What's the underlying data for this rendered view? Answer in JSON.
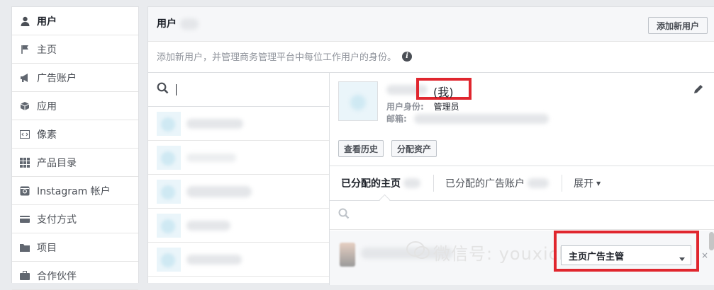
{
  "sidebar": {
    "items": [
      {
        "label": "用户",
        "icon": "person-icon"
      },
      {
        "label": "主页",
        "icon": "flag-icon"
      },
      {
        "label": "广告账户",
        "icon": "megaphone-icon"
      },
      {
        "label": "应用",
        "icon": "cube-icon"
      },
      {
        "label": "像素",
        "icon": "code-icon"
      },
      {
        "label": "产品目录",
        "icon": "grid-icon"
      },
      {
        "label": "Instagram 帐户",
        "icon": "instagram-icon"
      },
      {
        "label": "支付方式",
        "icon": "credit-card-icon"
      },
      {
        "label": "项目",
        "icon": "folder-icon"
      },
      {
        "label": "合作伙伴",
        "icon": "briefcase-icon"
      }
    ]
  },
  "header": {
    "title": "用户",
    "add_button": "添加新用户"
  },
  "description": "添加新用户，并管理商务管理平台中每位工作用户的身份。",
  "detail": {
    "me_label": "(我)",
    "role_label": "用户身份:",
    "role_value": "管理员",
    "email_label": "邮箱:",
    "history_button": "查看历史",
    "assign_button": "分配资产"
  },
  "tabs": {
    "pages": "已分配的主页",
    "ad_accounts": "已分配的广告账户",
    "expand": "展开"
  },
  "asset": {
    "watermark": "微信号: youxichaguan",
    "role_select": "主页广告主管",
    "remove": "×"
  },
  "colors": {
    "highlight": "#e0262e",
    "link": "#4267b2"
  }
}
